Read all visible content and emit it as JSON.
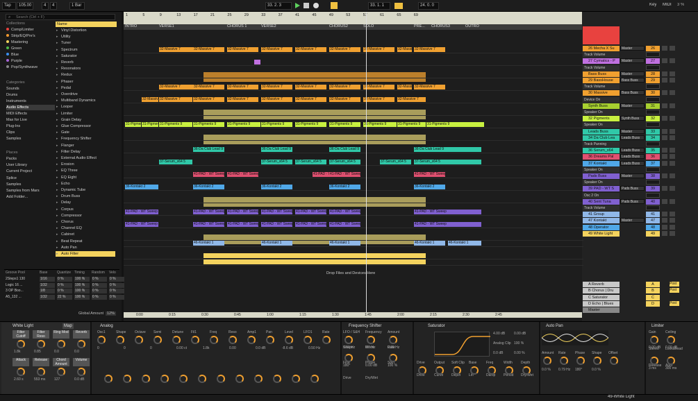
{
  "transport": {
    "tap": "Tap",
    "tempo": "105.00",
    "sig_num": "4",
    "sig_den": "4",
    "quant": "1 Bar",
    "position": "33. 2. 3",
    "loop_start": "33. 1. 1",
    "loop_len": "24. 0. 0",
    "key": "Key",
    "midi": "MIDI",
    "cpu": "3 %"
  },
  "browser": {
    "search_placeholder": "Search (Ctrl + F)",
    "collections_h": "Collections",
    "collections": [
      {
        "label": "Comp/Limiter",
        "color": "#e8423f"
      },
      {
        "label": "Strip/EQ/Pre's",
        "color": "#f59a2f"
      },
      {
        "label": "Mastering",
        "color": "#f4d35e"
      },
      {
        "label": "Green",
        "color": "#4cb848"
      },
      {
        "label": "Blue",
        "color": "#3b8ff0"
      },
      {
        "label": "Purple",
        "color": "#a865d8"
      },
      {
        "label": "Pop/Synthwave",
        "color": "#888888"
      }
    ],
    "categories_h": "Categories",
    "categories": [
      "Sounds",
      "Drums",
      "Instruments",
      "Audio Effects",
      "MIDI Effects",
      "Max for Live",
      "Plug-Ins",
      "Clips",
      "Samples"
    ],
    "places_h": "Places",
    "places": [
      "Packs",
      "User Library",
      "Current Project",
      "Splice",
      "Samples",
      "Samples from Mars",
      "Add Folder..."
    ],
    "name_header": "Name",
    "items": [
      "Vinyl Distortion",
      "Utility",
      "Tuner",
      "Spectrum",
      "Saturator",
      "Reverb",
      "Resonators",
      "Redux",
      "Phaser",
      "Pedal",
      "Overdrive",
      "Multiband Dynamics",
      "Looper",
      "Limiter",
      "Grain Delay",
      "Glue Compressor",
      "Gate",
      "Frequency Shifter",
      "Flanger",
      "Filter Delay",
      "External Audio Effect",
      "Erosion",
      "EQ Three",
      "EQ Eight",
      "Echo",
      "Dynamic Tube",
      "Drum Buss",
      "Delay",
      "Corpus",
      "Compressor",
      "Chorus",
      "Channel EQ",
      "Cabinet",
      "Beat Repeat",
      "Auto Pan",
      "Auto Filter"
    ]
  },
  "groove": {
    "headers": [
      "Groove Pool",
      "Base",
      "Quantize",
      "Timing",
      "Random",
      "Velo"
    ],
    "rows": [
      [
        "2Steps1 130",
        "1/16",
        "0 %",
        "100 %",
        "0 %",
        "0 %"
      ],
      [
        "Logic 16 ...",
        "1/32",
        "0 %",
        "100 %",
        "0 %",
        "0 %"
      ],
      [
        "3 OP Boo...",
        "1/8",
        "0 %",
        "100 %",
        "0 %",
        "0 %"
      ],
      [
        "A5_132 ...",
        "1/32",
        "22 %",
        "100 %",
        "0 %",
        "0 %"
      ]
    ],
    "global": "Global Amount",
    "global_val": "12%",
    "placeholder": "Groove Pool"
  },
  "arrangement": {
    "bars": [
      "1",
      "5",
      "9",
      "13",
      "17",
      "21",
      "25",
      "29",
      "33",
      "37",
      "41",
      "45",
      "49",
      "53",
      "57",
      "61",
      "65",
      "69"
    ],
    "locators": [
      "INTRO",
      "VERSE1",
      "CHORUS 1",
      "VERSE2",
      "CHORUS2",
      "SOLO",
      "PRE...",
      "CHORUS3",
      "OUTRO"
    ],
    "times": [
      "0:00",
      "0:15",
      "0:30",
      "0:45",
      "1:00",
      "1:15",
      "1:30",
      "1:45",
      "2:00",
      "2:15",
      "2:30",
      "2:45"
    ],
    "drop_text": "Drop Files and Devices Here",
    "clip_names": {
      "massive": "32-Massive 7",
      "pigments": "31-Pigments 9",
      "clublead": "36-Da Club Lead 9",
      "serum": "37-Serum_x64 5",
      "pad1": "41-PAD - WT Sweep",
      "kontakt": "36-Kontakt 2",
      "pad2": "41-PAD - WT Sweep",
      "kontakt46": "46-Kontakt 1",
      "pad3": "41-PAD - WT Sweep 3"
    }
  },
  "tracks": [
    {
      "name": "26 Mecha X Su",
      "route": "Master",
      "num": "26",
      "color": "#f0a030"
    },
    {
      "name": "Track Volume",
      "route": "",
      "num": "",
      "color": ""
    },
    {
      "name": "27 Cymatics - P",
      "route": "Master",
      "num": "27",
      "color": "#c070e0"
    },
    {
      "name": "Track Volume",
      "route": "",
      "num": "",
      "color": ""
    },
    {
      "name": "Bass Buss",
      "route": "Master",
      "num": "28",
      "color": "#f0a030"
    },
    {
      "name": "29 BassHouse",
      "route": "Bass Buss",
      "num": "29",
      "color": "#f0a030"
    },
    {
      "name": "Track Volume",
      "route": "",
      "num": "",
      "color": ""
    },
    {
      "name": "30 Massive",
      "route": "Bass Buss",
      "num": "30",
      "color": "#f0a030"
    },
    {
      "name": "Device On",
      "route": "",
      "num": "",
      "color": ""
    },
    {
      "name": "Synth Buss",
      "route": "Master",
      "num": "31",
      "color": "#a8d030"
    },
    {
      "name": "Speaker On",
      "route": "",
      "num": "",
      "color": ""
    },
    {
      "name": "32 Pigments",
      "route": "Synth Buss",
      "num": "32",
      "color": "#c8f040"
    },
    {
      "name": "Speaker On",
      "route": "",
      "num": "",
      "color": ""
    },
    {
      "name": "Leads Buss",
      "route": "Master",
      "num": "33",
      "color": "#30c8a8"
    },
    {
      "name": "34 Da Club Lea",
      "route": "Leads Buss",
      "num": "34",
      "color": "#30c8a8"
    },
    {
      "name": "Track Panning",
      "route": "",
      "num": "",
      "color": ""
    },
    {
      "name": "36 Serum_x64",
      "route": "Leads Buss",
      "num": "35",
      "color": "#30c8a8"
    },
    {
      "name": "36 Dreams Pal",
      "route": "Leads Buss",
      "num": "36",
      "color": "#e05070"
    },
    {
      "name": "37 Kontakt",
      "route": "Leads Buss",
      "num": "37",
      "color": "#50a8e8"
    },
    {
      "name": "Speaker On",
      "route": "",
      "num": "",
      "color": ""
    },
    {
      "name": "Pads Buss",
      "route": "Master",
      "num": "38",
      "color": "#8060d0"
    },
    {
      "name": "Speaker On",
      "route": "",
      "num": "",
      "color": ""
    },
    {
      "name": "39 PAD - WT S",
      "route": "Pads Buss",
      "num": "39",
      "color": "#8060d0"
    },
    {
      "name": "Osc 2 On",
      "route": "",
      "num": "",
      "color": ""
    },
    {
      "name": "40 Sent Tuna",
      "route": "Pads Buss",
      "num": "40",
      "color": "#8060d0"
    },
    {
      "name": "Track Volume",
      "route": "",
      "num": "",
      "color": ""
    },
    {
      "name": "41 Group",
      "route": "",
      "num": "41",
      "color": "#90b8e8"
    },
    {
      "name": "47 Kontakt",
      "route": "Master",
      "num": "47",
      "color": "#90b8e8"
    },
    {
      "name": "48 Operator",
      "route": "",
      "num": "48",
      "color": "#50a8e8"
    },
    {
      "name": "49 White Light",
      "route": "",
      "num": "49",
      "color": "#f4d35e"
    }
  ],
  "returns": [
    {
      "name": "A Reverb",
      "letter": "A",
      "post": "Post"
    },
    {
      "name": "B Chorus | Dru",
      "letter": "B",
      "post": "Post"
    },
    {
      "name": "C Saturator",
      "letter": "C",
      "post": ""
    },
    {
      "name": "D Echo | Blues",
      "letter": "D",
      "post": "Post"
    },
    {
      "name": "Master",
      "letter": "",
      "post": ""
    }
  ],
  "devices": {
    "rack_title": "White Light",
    "rack_map": "Map",
    "macros": [
      "Filter Cutoff",
      "Filter Reso",
      "Ring Mod",
      "Reverb",
      "Attack",
      "Release",
      "Chord Amount",
      "Volume"
    ],
    "macro_vals": [
      "1.8k",
      "0.85",
      "0.0",
      "0.0",
      "2.60 s",
      "553 ms",
      "127",
      "0.0 dB"
    ],
    "analog": "Analog",
    "analog_labels": [
      "Osc1",
      "Shape",
      "Octave",
      "Semi",
      "Detune",
      "Fil1",
      "Freq",
      "Reso",
      "Amp1",
      "Pan",
      "Level",
      "LFO1",
      "Rate"
    ],
    "analog_vals": [
      "0",
      "0",
      "0",
      "0.00 ct",
      "1.8k",
      "0.00",
      "0.0 dB",
      "-8.6 dB",
      "0.50 Hz"
    ],
    "fs": "Frequency Shifter",
    "fs_labels": [
      "LFO / S&H",
      "Frequency",
      "Amount",
      "Shape",
      "Mode",
      "Rate",
      "Fine",
      "Phase",
      "Spin",
      "Drive",
      "Dry/Wet"
    ],
    "fs_vals": [
      "0.00 Hz",
      "0.0 Hz",
      "0.00 Hz",
      "180°",
      "0.00 dB",
      "100 %"
    ],
    "sat": "Saturator",
    "sat_labels": [
      "Drive",
      "Output",
      "Soft Clip",
      "Base",
      "Freq",
      "Width",
      "Depth",
      "Drive",
      "Curve",
      "Depth",
      "Lin",
      "Damp",
      "Period",
      "Dry/Wet"
    ],
    "sat_vals": [
      "4.00 dB",
      "0.00 dB",
      "Analog Clip",
      "100 %",
      "0.0 dB",
      "0.00 %"
    ],
    "autopan": "Auto Pan",
    "ap_labels": [
      "Amount",
      "Rate",
      "Phase",
      "Shape",
      "Offset"
    ],
    "ap_vals": [
      "0.0 %",
      "0.79 Hz",
      "180°",
      "0.0 %"
    ],
    "limiter": "Limiter",
    "lim_labels": [
      "Gain",
      "Ceiling",
      "Stereo",
      "Lookahead",
      "Release",
      "Auto"
    ],
    "lim_vals": [
      "0.00 dB",
      "0.00 dB",
      "3 ms",
      "300 ms"
    ],
    "status": "49-White Light"
  }
}
